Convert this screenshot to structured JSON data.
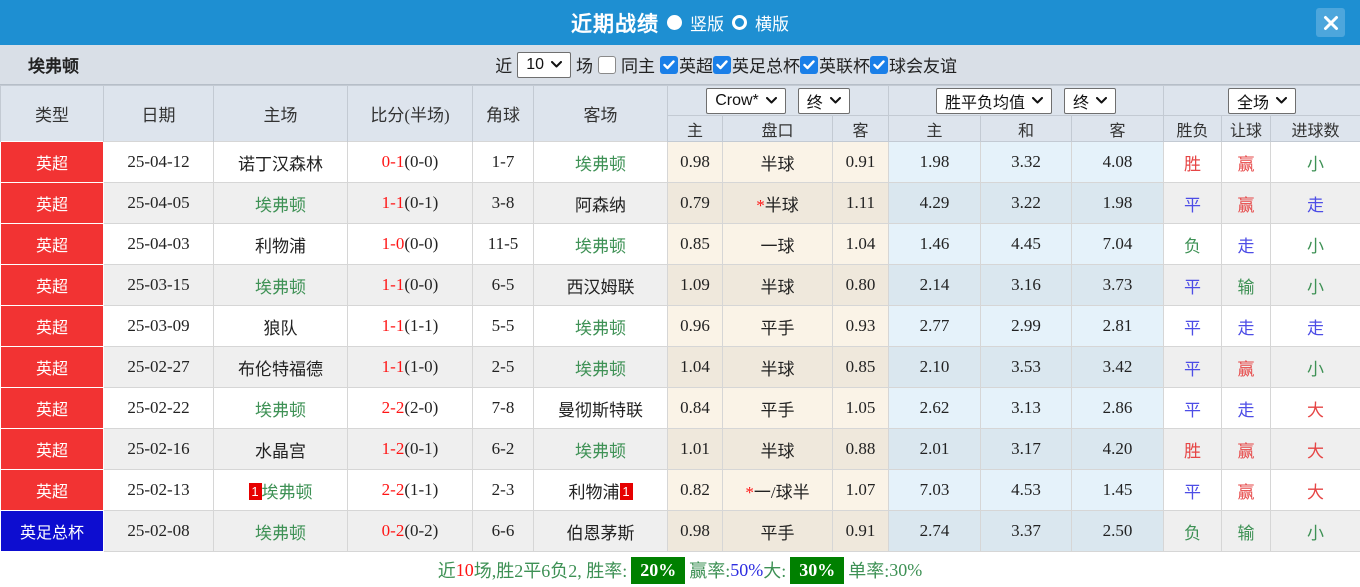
{
  "titlebar": {
    "title": "近期战绩",
    "radio_vertical": "竖版",
    "radio_horizontal": "横版",
    "selected_layout": "竖版"
  },
  "filterbar": {
    "team": "埃弗顿",
    "recent_label": "近",
    "recent_value": "10",
    "games_label": "场",
    "same_home_label": "同主",
    "leagues": [
      "英超",
      "英足总杯",
      "英联杯",
      "球会友谊"
    ]
  },
  "controls": {
    "bookmaker_select": "Crow*",
    "bookmaker_time_select": "终",
    "europe_select": "胜平负均值",
    "europe_time_select": "终",
    "scope_select": "全场"
  },
  "columns": {
    "type": "类型",
    "date": "日期",
    "home": "主场",
    "score": "比分(半场)",
    "corner": "角球",
    "away": "客场",
    "h_home": "主",
    "h_line": "盘口",
    "h_away": "客",
    "e_home": "主",
    "e_draw": "和",
    "e_away": "客",
    "result": "胜负",
    "handicap": "让球",
    "goals": "进球数"
  },
  "rows": [
    {
      "type": "英超",
      "badge": "red",
      "date": "25-04-12",
      "home": "诺丁汉森林",
      "home_self": false,
      "home_card": "",
      "score": "0-1",
      "half": "(0-0)",
      "corner": "1-7",
      "away": "埃弗顿",
      "away_self": true,
      "away_card": "",
      "hh": "0.98",
      "star": false,
      "line": "半球",
      "ha": "0.91",
      "eh": "1.98",
      "ed": "3.32",
      "ea": "4.08",
      "res": [
        "胜",
        "r"
      ],
      "let": [
        "赢",
        "r"
      ],
      "goal": [
        "小",
        "g"
      ]
    },
    {
      "type": "英超",
      "badge": "red",
      "date": "25-04-05",
      "home": "埃弗顿",
      "home_self": true,
      "home_card": "",
      "score": "1-1",
      "half": "(0-1)",
      "corner": "3-8",
      "away": "阿森纳",
      "away_self": false,
      "away_card": "",
      "hh": "0.79",
      "star": true,
      "line": "半球",
      "ha": "1.11",
      "eh": "4.29",
      "ed": "3.22",
      "ea": "1.98",
      "res": [
        "平",
        "b"
      ],
      "let": [
        "赢",
        "r"
      ],
      "goal": [
        "走",
        "b"
      ]
    },
    {
      "type": "英超",
      "badge": "red",
      "date": "25-04-03",
      "home": "利物浦",
      "home_self": false,
      "home_card": "",
      "score": "1-0",
      "half": "(0-0)",
      "corner": "11-5",
      "away": "埃弗顿",
      "away_self": true,
      "away_card": "",
      "hh": "0.85",
      "star": false,
      "line": "一球",
      "ha": "1.04",
      "eh": "1.46",
      "ed": "4.45",
      "ea": "7.04",
      "res": [
        "负",
        "g"
      ],
      "let": [
        "走",
        "b"
      ],
      "goal": [
        "小",
        "g"
      ]
    },
    {
      "type": "英超",
      "badge": "red",
      "date": "25-03-15",
      "home": "埃弗顿",
      "home_self": true,
      "home_card": "",
      "score": "1-1",
      "half": "(0-0)",
      "corner": "6-5",
      "away": "西汉姆联",
      "away_self": false,
      "away_card": "",
      "hh": "1.09",
      "star": false,
      "line": "半球",
      "ha": "0.80",
      "eh": "2.14",
      "ed": "3.16",
      "ea": "3.73",
      "res": [
        "平",
        "b"
      ],
      "let": [
        "输",
        "g"
      ],
      "goal": [
        "小",
        "g"
      ]
    },
    {
      "type": "英超",
      "badge": "red",
      "date": "25-03-09",
      "home": "狼队",
      "home_self": false,
      "home_card": "",
      "score": "1-1",
      "half": "(1-1)",
      "corner": "5-5",
      "away": "埃弗顿",
      "away_self": true,
      "away_card": "",
      "hh": "0.96",
      "star": false,
      "line": "平手",
      "ha": "0.93",
      "eh": "2.77",
      "ed": "2.99",
      "ea": "2.81",
      "res": [
        "平",
        "b"
      ],
      "let": [
        "走",
        "b"
      ],
      "goal": [
        "走",
        "b"
      ]
    },
    {
      "type": "英超",
      "badge": "red",
      "date": "25-02-27",
      "home": "布伦特福德",
      "home_self": false,
      "home_card": "",
      "score": "1-1",
      "half": "(1-0)",
      "corner": "2-5",
      "away": "埃弗顿",
      "away_self": true,
      "away_card": "",
      "hh": "1.04",
      "star": false,
      "line": "半球",
      "ha": "0.85",
      "eh": "2.10",
      "ed": "3.53",
      "ea": "3.42",
      "res": [
        "平",
        "b"
      ],
      "let": [
        "赢",
        "r"
      ],
      "goal": [
        "小",
        "g"
      ]
    },
    {
      "type": "英超",
      "badge": "red",
      "date": "25-02-22",
      "home": "埃弗顿",
      "home_self": true,
      "home_card": "",
      "score": "2-2",
      "half": "(2-0)",
      "corner": "7-8",
      "away": "曼彻斯特联",
      "away_self": false,
      "away_card": "",
      "hh": "0.84",
      "star": false,
      "line": "平手",
      "ha": "1.05",
      "eh": "2.62",
      "ed": "3.13",
      "ea": "2.86",
      "res": [
        "平",
        "b"
      ],
      "let": [
        "走",
        "b"
      ],
      "goal": [
        "大",
        "r"
      ]
    },
    {
      "type": "英超",
      "badge": "red",
      "date": "25-02-16",
      "home": "水晶宫",
      "home_self": false,
      "home_card": "",
      "score": "1-2",
      "half": "(0-1)",
      "corner": "6-2",
      "away": "埃弗顿",
      "away_self": true,
      "away_card": "",
      "hh": "1.01",
      "star": false,
      "line": "半球",
      "ha": "0.88",
      "eh": "2.01",
      "ed": "3.17",
      "ea": "4.20",
      "res": [
        "胜",
        "r"
      ],
      "let": [
        "赢",
        "r"
      ],
      "goal": [
        "大",
        "r"
      ]
    },
    {
      "type": "英超",
      "badge": "red",
      "date": "25-02-13",
      "home": "埃弗顿",
      "home_self": true,
      "home_card": "1",
      "score": "2-2",
      "half": "(1-1)",
      "corner": "2-3",
      "away": "利物浦",
      "away_self": false,
      "away_card": "1",
      "hh": "0.82",
      "star": true,
      "line": "一/球半",
      "ha": "1.07",
      "eh": "7.03",
      "ed": "4.53",
      "ea": "1.45",
      "res": [
        "平",
        "b"
      ],
      "let": [
        "赢",
        "r"
      ],
      "goal": [
        "大",
        "r"
      ]
    },
    {
      "type": "英足总杯",
      "badge": "blue",
      "date": "25-02-08",
      "home": "埃弗顿",
      "home_self": true,
      "home_card": "",
      "score": "0-2",
      "half": "(0-2)",
      "corner": "6-6",
      "away": "伯恩茅斯",
      "away_self": false,
      "away_card": "",
      "hh": "0.98",
      "star": false,
      "line": "平手",
      "ha": "0.91",
      "eh": "2.74",
      "ed": "3.37",
      "ea": "2.50",
      "res": [
        "负",
        "g"
      ],
      "let": [
        "输",
        "g"
      ],
      "goal": [
        "小",
        "g"
      ]
    }
  ],
  "footer": {
    "segments": [
      {
        "text": "近",
        "c": "green"
      },
      {
        "text": "10",
        "c": "red"
      },
      {
        "text": "场,胜2平6负2, 胜率:",
        "c": "green"
      },
      {
        "text": "20%",
        "c": "badge"
      },
      {
        "text": "赢率:",
        "c": "green"
      },
      {
        "text": "50%",
        "c": "blue"
      },
      {
        "text": " 大:",
        "c": "green"
      },
      {
        "text": "30%",
        "c": "badge"
      },
      {
        "text": "单率:",
        "c": "green"
      },
      {
        "text": "30%",
        "c": "green"
      }
    ]
  }
}
